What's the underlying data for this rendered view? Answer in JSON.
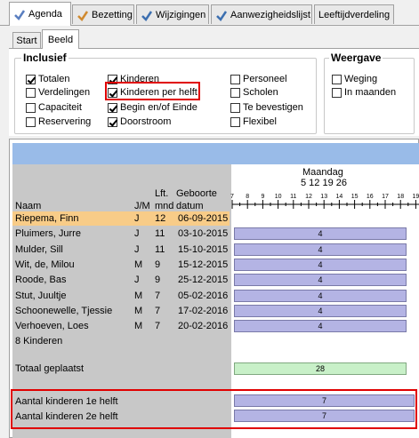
{
  "tabs": [
    {
      "label": "Agenda",
      "icon": "agenda-icon",
      "active": true
    },
    {
      "label": "Bezetting",
      "icon": "bezetting-icon",
      "active": false
    },
    {
      "label": "Wijzigingen",
      "icon": "wijzigingen-icon",
      "active": false
    },
    {
      "label": "Aanwezigheidslijst",
      "icon": "aanwezigheid-icon",
      "active": false
    },
    {
      "label": "Leeftijdverdeling",
      "icon": "",
      "active": false
    }
  ],
  "subtabs": [
    {
      "label": "Start",
      "active": false
    },
    {
      "label": "Beeld",
      "active": true
    }
  ],
  "inclusief": {
    "title": "Inclusief",
    "options": [
      {
        "label": "Totalen",
        "checked": true
      },
      {
        "label": "Verdelingen",
        "checked": false
      },
      {
        "label": "Capaciteit",
        "checked": false
      },
      {
        "label": "Reservering",
        "checked": false
      },
      {
        "label": "Kinderen",
        "checked": true
      },
      {
        "label": "Kinderen per helft",
        "checked": true
      },
      {
        "label": "Begin en/of Einde",
        "checked": true
      },
      {
        "label": "Doorstroom",
        "checked": true
      },
      {
        "label": "Personeel",
        "checked": false
      },
      {
        "label": "Scholen",
        "checked": false
      },
      {
        "label": "Te bevestigen",
        "checked": false
      },
      {
        "label": "Flexibel",
        "checked": false
      }
    ]
  },
  "weergave": {
    "title": "Weergave",
    "options": [
      {
        "label": "Weging",
        "checked": false
      },
      {
        "label": "In maanden",
        "checked": false
      }
    ]
  },
  "header": {
    "naam": "Naam",
    "jm": "J/M",
    "lft1": "Lft.",
    "lft2": "mnd",
    "geb1": "Geboorte",
    "geb2": "datum",
    "day": "Maandag",
    "date": "5 12 19 26",
    "hours": [
      "7",
      "8",
      "9",
      "10",
      "11",
      "12",
      "13",
      "14",
      "15",
      "16",
      "17",
      "18",
      "19"
    ]
  },
  "children": [
    {
      "naam": "Riepema, Finn",
      "jm": "J",
      "lft": "12",
      "datum": "06-09-2015",
      "value": "",
      "highlight": true
    },
    {
      "naam": "Pluimers, Jurre",
      "jm": "J",
      "lft": "11",
      "datum": "03-10-2015",
      "value": "4"
    },
    {
      "naam": "Mulder, Sill",
      "jm": "J",
      "lft": "11",
      "datum": "15-10-2015",
      "value": "4"
    },
    {
      "naam": "Wit, de, Milou",
      "jm": "M",
      "lft": "9",
      "datum": "15-12-2015",
      "value": "4"
    },
    {
      "naam": "Roode, Bas",
      "jm": "J",
      "lft": "9",
      "datum": "25-12-2015",
      "value": "4"
    },
    {
      "naam": "Stut, Juultje",
      "jm": "M",
      "lft": "7",
      "datum": "05-02-2016",
      "value": "4"
    },
    {
      "naam": "Schoonewelle, Tjessie",
      "jm": "M",
      "lft": "7",
      "datum": "17-02-2016",
      "value": "4"
    },
    {
      "naam": "Verhoeven, Loes",
      "jm": "M",
      "lft": "7",
      "datum": "20-02-2016",
      "value": "4"
    }
  ],
  "count_label": "8 Kinderen",
  "totaal": {
    "label": "Totaal geplaatst",
    "value": "28"
  },
  "helften": [
    {
      "label": "Aantal kinderen 1e helft",
      "value": "7"
    },
    {
      "label": "Aantal kinderen 2e helft",
      "value": "7"
    }
  ]
}
